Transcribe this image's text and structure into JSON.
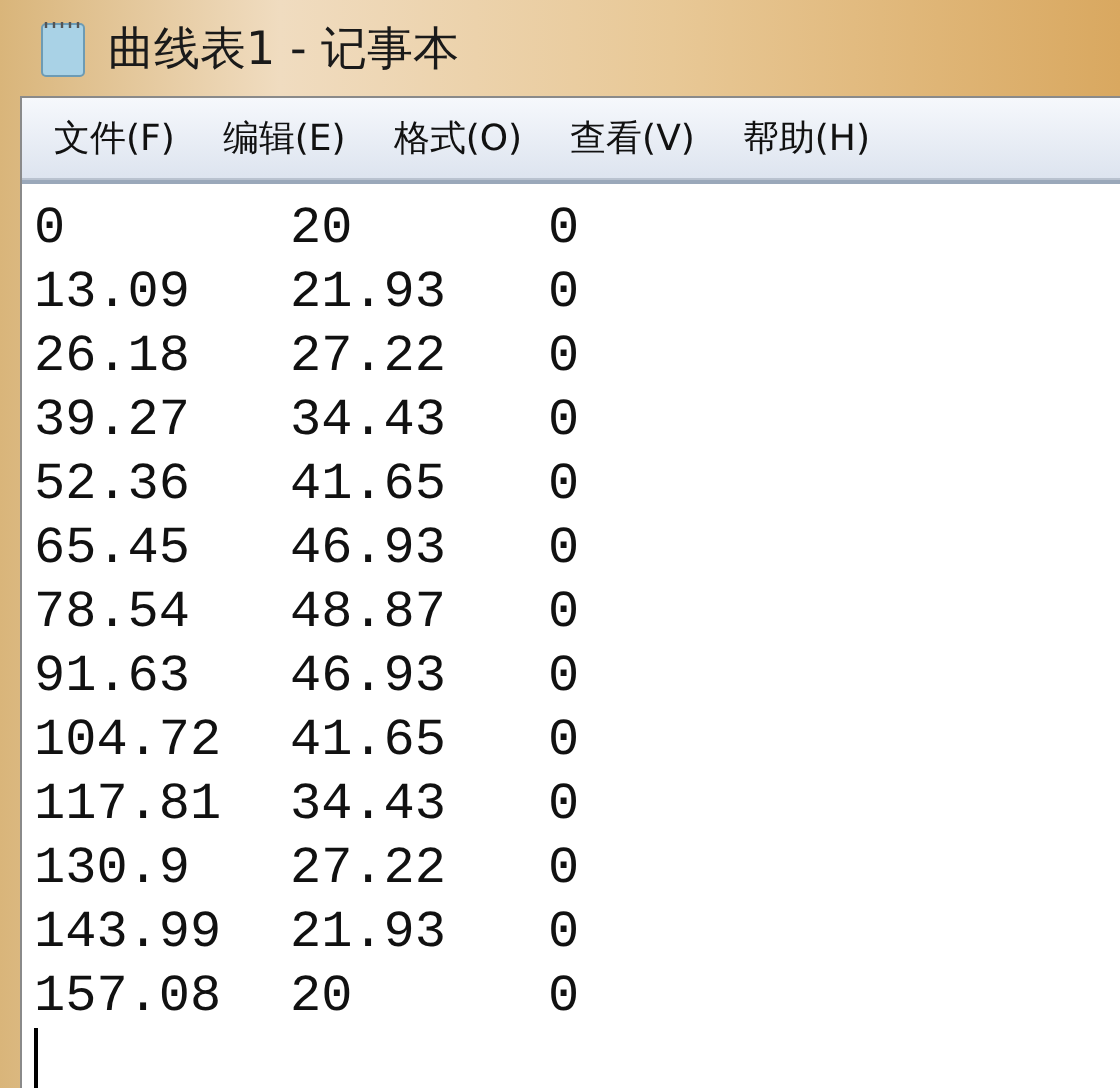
{
  "window": {
    "title": "曲线表1 - 记事本"
  },
  "menu": [
    "文件(F)",
    "编辑(E)",
    "格式(O)",
    "查看(V)",
    "帮助(H)"
  ],
  "lines": [
    [
      "0",
      "20",
      "0"
    ],
    [
      "13.09",
      "21.93",
      "0"
    ],
    [
      "26.18",
      "27.22",
      "0"
    ],
    [
      "39.27",
      "34.43",
      "0"
    ],
    [
      "52.36",
      "41.65",
      "0"
    ],
    [
      "65.45",
      "46.93",
      "0"
    ],
    [
      "78.54",
      "48.87",
      "0"
    ],
    [
      "91.63",
      "46.93",
      "0"
    ],
    [
      "104.72",
      "41.65",
      "0"
    ],
    [
      "117.81",
      "34.43",
      "0"
    ],
    [
      "130.9",
      "27.22",
      "0"
    ],
    [
      "143.99",
      "21.93",
      "0"
    ],
    [
      "157.08",
      "20",
      "0"
    ]
  ]
}
